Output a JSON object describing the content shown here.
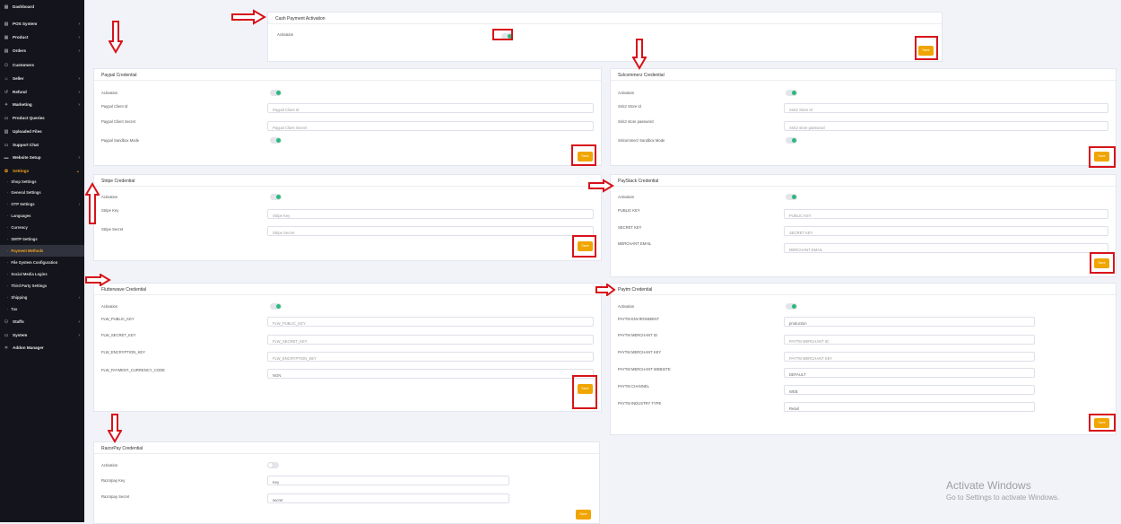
{
  "sidebar": {
    "items": [
      {
        "label": "Dashboard",
        "icon": "dashboard-icon"
      },
      {
        "label": "POS System",
        "icon": "pos-icon"
      },
      {
        "label": "Product",
        "icon": "product-icon"
      },
      {
        "label": "Orders",
        "icon": "orders-icon"
      },
      {
        "label": "Customers",
        "icon": "customers-icon"
      },
      {
        "label": "Seller",
        "icon": "seller-icon"
      },
      {
        "label": "Refund",
        "icon": "refund-icon"
      },
      {
        "label": "Marketing",
        "icon": "marketing-icon"
      },
      {
        "label": "Product Queries",
        "icon": "queries-icon"
      },
      {
        "label": "Uploaded Files",
        "icon": "files-icon"
      },
      {
        "label": "Support Chat",
        "icon": "chat-icon"
      },
      {
        "label": "Website Setup",
        "icon": "website-icon"
      },
      {
        "label": "Settings",
        "icon": "settings-icon"
      }
    ],
    "settings_sub": [
      "Shop Settings",
      "General Settings",
      "OTP Settings",
      "Languages",
      "Currency",
      "SMTP Settings",
      "Payment Methods",
      "File System Configuration",
      "Social Media Logins",
      "Third Party Settings",
      "Shipping",
      "Tax"
    ],
    "bottom": [
      {
        "label": "Staffs",
        "icon": "staffs-icon"
      },
      {
        "label": "System",
        "icon": "system-icon"
      },
      {
        "label": "Addon Manager",
        "icon": "addon-icon"
      }
    ]
  },
  "cash": {
    "title": "Cash Payment Activation",
    "activation_label": "Activation",
    "activation_on": true,
    "save": "Save"
  },
  "paypal": {
    "title": "Paypal Credential",
    "activation_label": "Activation",
    "client_id_label": "Paypal Client Id",
    "client_id_placeholder": "Paypal Client Id",
    "client_secret_label": "Paypal Client Secret",
    "client_secret_placeholder": "Paypal Client Secret",
    "sandbox_label": "Paypal Sandbox Mode",
    "save": "Save"
  },
  "sslcommerz": {
    "title": "Sslcommerz Credential",
    "activation_label": "Activation",
    "store_id_label": "Sslcz Store Id",
    "store_id_placeholder": "Sslcz Store Id",
    "store_password_label": "Sslcz store password",
    "store_password_placeholder": "Sslcz store password",
    "sandbox_label": "Sslcommerz Sandbox Mode",
    "save": "Save"
  },
  "stripe": {
    "title": "Stripe Credential",
    "activation_label": "Activation",
    "key_label": "Stripe Key",
    "key_placeholder": "Stripe Key",
    "secret_label": "Stripe Secret",
    "secret_placeholder": "Stripe Secret",
    "save": "Save"
  },
  "paystack": {
    "title": "PayStack Credential",
    "activation_label": "Activation",
    "public_key_label": "PUBLIC KEY",
    "public_key_placeholder": "PUBLIC KEY",
    "secret_key_label": "SECRET KEY",
    "secret_key_placeholder": "SECRET KEY",
    "merchant_email_label": "MERCHANT EMAIL",
    "merchant_email_placeholder": "MERCHANT EMAIL",
    "save": "Save"
  },
  "flutterwave": {
    "title": "Flutterwave Credential",
    "activation_label": "Activation",
    "public_key_label": "FLW_PUBLIC_KEY",
    "public_key_placeholder": "FLW_PUBLIC_KEY",
    "secret_key_label": "FLW_SECRET_KEY",
    "secret_key_placeholder": "FLW_SECRET_KEY",
    "encryption_key_label": "FLW_ENCRYPTION_KEY",
    "encryption_key_placeholder": "FLW_ENCRYPTION_KEY",
    "currency_label": "FLW_PAYMENT_CURRENCY_CODE",
    "currency_value": "NGN",
    "save": "Save"
  },
  "paytm": {
    "title": "Paytm Credential",
    "activation_label": "Activation",
    "environment_label": "PAYTM ENVIRONMENT",
    "environment_value": "production",
    "merchant_id_label": "PAYTM MERCHANT ID",
    "merchant_id_placeholder": "PAYTM MERCHANT ID",
    "merchant_key_label": "PAYTM MERCHANT KEY",
    "merchant_key_placeholder": "PAYTM MERCHANT KEY",
    "merchant_website_label": "PAYTM MERCHANT WEBSITE",
    "merchant_website_value": "DEFAULT",
    "channel_label": "PAYTM CHANNEL",
    "channel_value": "WEB",
    "industry_label": "PAYTM INDUSTRY TYPE",
    "industry_value": "Retail",
    "save": "Save"
  },
  "razorpay": {
    "title": "RazorPay Credential",
    "activation_label": "Activation",
    "key_label": "Razorpay Key",
    "key_value": "Key",
    "secret_label": "Razorpay Secret",
    "secret_value": "secret",
    "save": "Save"
  },
  "watermark": {
    "line1": "Activate Windows",
    "line2": "Go to Settings to activate Windows."
  },
  "colors": {
    "sidebar_bg": "#14151c",
    "accent": "#f0a500",
    "toggle_on": "#2db87d",
    "annotation": "#d7131a"
  }
}
